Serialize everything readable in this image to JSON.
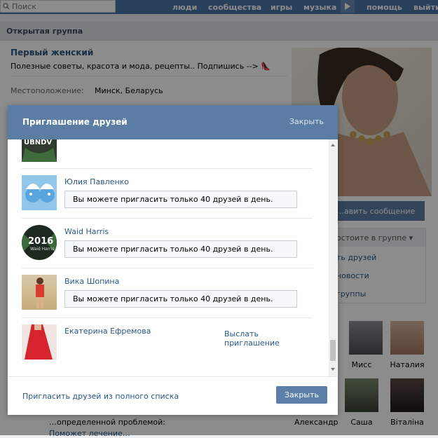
{
  "topbar": {
    "search_placeholder": "Поиск",
    "nav": [
      "люди",
      "сообщества",
      "игры",
      "музыка",
      "помощь",
      "выйти"
    ]
  },
  "subheader": "Открытая группа",
  "group": {
    "title": "Первый женский",
    "status": "Полезные советы, красота и мода, рецепты.. Подпишись --> 👠",
    "location_label": "Местоположение:",
    "location_value": "Минск, Беларусь"
  },
  "right_panel": {
    "button": "…авить сообщение",
    "menu_head": "…остоите в группе ▾",
    "menu_items": [
      "…ть друзей",
      "…новости",
      "…группы"
    ],
    "friends": [
      {
        "name": "Мисс"
      },
      {
        "name": "Наталия"
      },
      {
        "name": "Александр"
      },
      {
        "name": "Саша"
      },
      {
        "name": "Віталіна"
      }
    ]
  },
  "bottom_text": {
    "line1": "…определенной проблемой:",
    "line2": "Поможет лечение…"
  },
  "modal": {
    "title": "Приглашение друзей",
    "close_link": "Закрыть",
    "rows": [
      {
        "name": "Юлия Павленко",
        "notice": "Вы можете пригласить только 40 друзей в день."
      },
      {
        "name": "Waid Harris",
        "notice": "Вы можете пригласить только 40 друзей в день."
      },
      {
        "name": "Вика Шопина",
        "notice": "Вы можете пригласить только 40 друзей в день."
      },
      {
        "name": "Екатерина Ефремова",
        "action": "Выслать приглашение"
      }
    ],
    "footer_link": "Пригласить друзей из полного списка",
    "footer_button": "Закрыть"
  }
}
